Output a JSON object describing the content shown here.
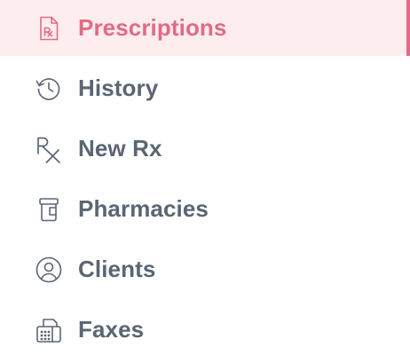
{
  "sidebar": {
    "accent_color": "#e36a86",
    "active_bg_color": "#fdedee",
    "text_color": "#5b6573",
    "items": [
      {
        "label": "Prescriptions",
        "icon": "prescription-doc-icon",
        "active": true
      },
      {
        "label": "History",
        "icon": "history-icon",
        "active": false
      },
      {
        "label": "New Rx",
        "icon": "rx-icon",
        "active": false
      },
      {
        "label": "Pharmacies",
        "icon": "pill-bottle-icon",
        "active": false
      },
      {
        "label": "Clients",
        "icon": "user-circle-icon",
        "active": false
      },
      {
        "label": "Faxes",
        "icon": "fax-icon",
        "active": false
      }
    ]
  }
}
